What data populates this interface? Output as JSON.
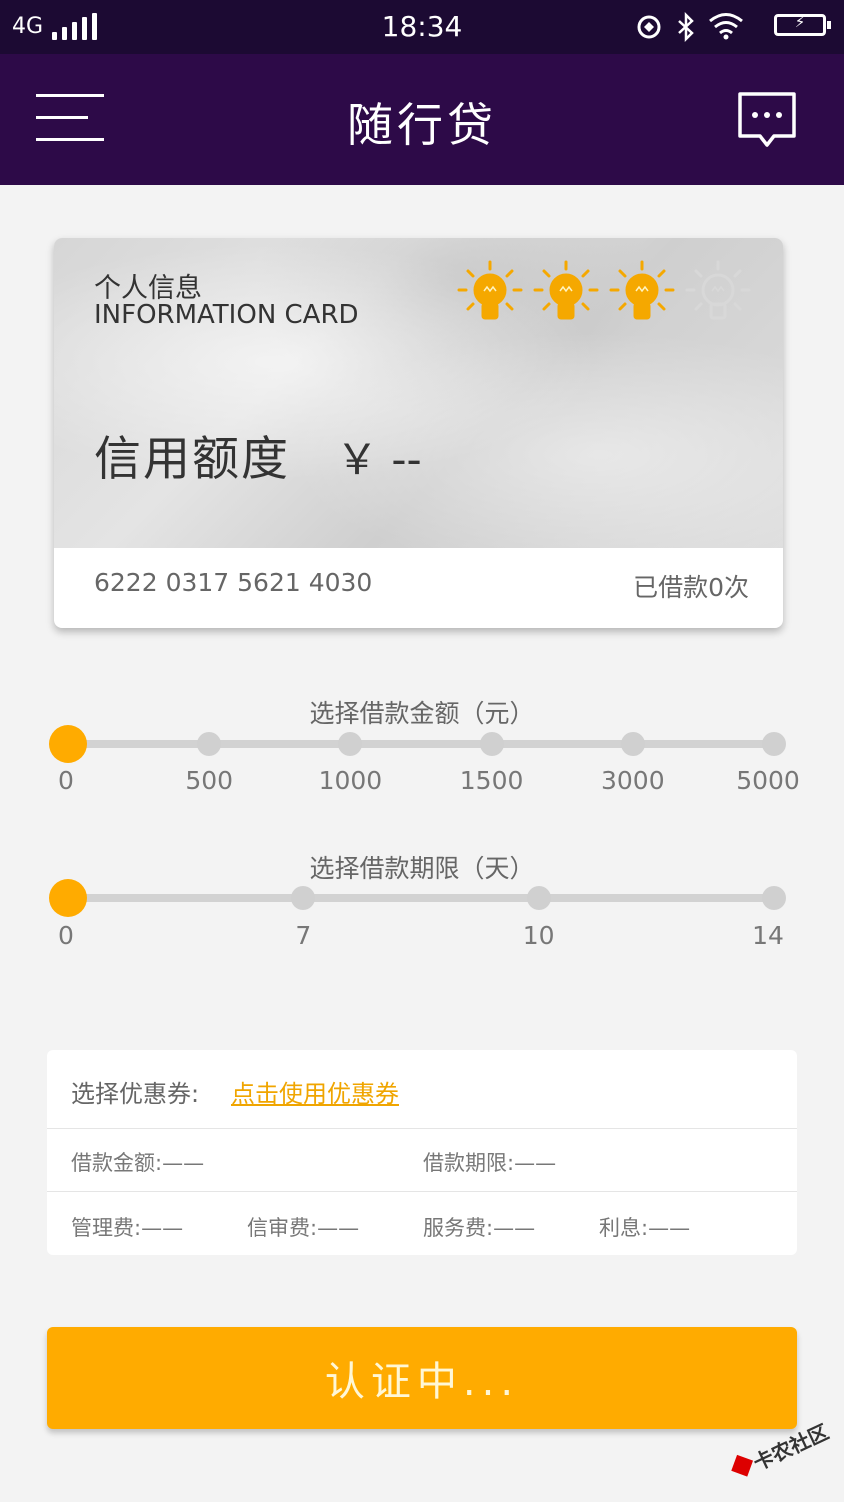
{
  "status_bar": {
    "network": "4G",
    "time": "18:34",
    "battery": "⚡"
  },
  "header": {
    "title": "随行贷"
  },
  "card": {
    "label_cn": "个人信息",
    "label_en": "INFORMATION CARD",
    "credit_label": "信用额度",
    "credit_value": "￥ --",
    "card_number": "6222 0317 5621 4030",
    "borrow_count": "已借款0次",
    "bulbs_lit": 3,
    "bulbs_total": 4
  },
  "amount_slider": {
    "title": "选择借款金额（元）",
    "ticks": [
      "0",
      "500",
      "1000",
      "1500",
      "3000",
      "5000"
    ],
    "selected_index": 0
  },
  "term_slider": {
    "title": "选择借款期限（天）",
    "ticks": [
      "0",
      "7",
      "10",
      "14"
    ],
    "selected_index": 0
  },
  "info": {
    "coupon_label": "选择优惠券:",
    "coupon_link": "点击使用优惠券",
    "loan_amount": "借款金额:——",
    "loan_term": "借款期限:——",
    "management_fee": "管理费:——",
    "review_fee": "信审费:——",
    "service_fee": "服务费:——",
    "interest": "利息:——"
  },
  "submit_label": "认证中...",
  "watermark": "卡农社区",
  "colors": {
    "status_bar": "#1c0a33",
    "header": "#2d0a48",
    "accent": "#ffab00",
    "bulb_lit": "#f5a800",
    "bulb_off": "#d8d8d8"
  },
  "icons": {
    "menu": "menu-icon",
    "message": "message-icon",
    "bulb": "lightbulb-icon"
  }
}
